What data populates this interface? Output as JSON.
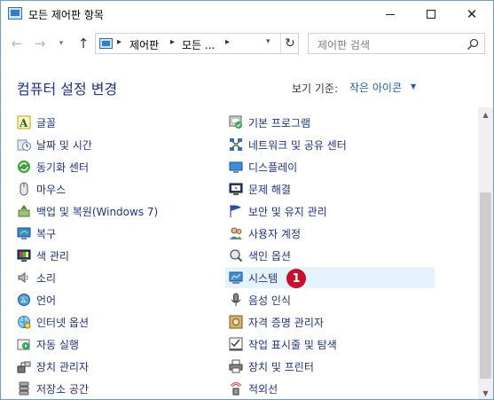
{
  "window": {
    "title": "모든 제어판 항목"
  },
  "nav": {
    "breadcrumb": [
      "제어판",
      "모든 ..."
    ],
    "search_placeholder": "제어판 검색"
  },
  "header": {
    "title": "컴퓨터 설정 변경",
    "view_by_label": "보기 기준:",
    "view_by_value": "작은 아이콘"
  },
  "items_left": [
    {
      "label": "글꼴",
      "icon": "font-icon"
    },
    {
      "label": "날짜 및 시간",
      "icon": "clock-icon"
    },
    {
      "label": "동기화 센터",
      "icon": "sync-icon"
    },
    {
      "label": "마우스",
      "icon": "mouse-icon"
    },
    {
      "label": "백업 및 복원(Windows 7)",
      "icon": "backup-icon"
    },
    {
      "label": "복구",
      "icon": "recovery-icon"
    },
    {
      "label": "색 관리",
      "icon": "color-management-icon"
    },
    {
      "label": "소리",
      "icon": "speaker-icon"
    },
    {
      "label": "언어",
      "icon": "language-icon"
    },
    {
      "label": "인터넷 옵션",
      "icon": "internet-options-icon"
    },
    {
      "label": "자동 실행",
      "icon": "autoplay-icon"
    },
    {
      "label": "장치 관리자",
      "icon": "device-manager-icon"
    },
    {
      "label": "저장소 공간",
      "icon": "storage-icon"
    }
  ],
  "items_right": [
    {
      "label": "기본 프로그램",
      "icon": "default-programs-icon"
    },
    {
      "label": "네트워크 및 공유 센터",
      "icon": "network-icon"
    },
    {
      "label": "디스플레이",
      "icon": "display-icon"
    },
    {
      "label": "문제 해결",
      "icon": "troubleshoot-icon"
    },
    {
      "label": "보안 및 유지 관리",
      "icon": "security-flag-icon"
    },
    {
      "label": "사용자 계정",
      "icon": "user-accounts-icon"
    },
    {
      "label": "색인 옵션",
      "icon": "indexing-icon"
    },
    {
      "label": "시스템",
      "icon": "system-icon"
    },
    {
      "label": "음성 인식",
      "icon": "microphone-icon"
    },
    {
      "label": "자격 증명 관리자",
      "icon": "credential-icon"
    },
    {
      "label": "작업 표시줄 및 탐색",
      "icon": "taskbar-icon"
    },
    {
      "label": "장치 및 프린터",
      "icon": "printer-icon"
    },
    {
      "label": "적외선",
      "icon": "infrared-icon"
    }
  ],
  "selected_item": "시스템",
  "annotation_badge": "1",
  "colors": {
    "link": "#1e3287",
    "selected_bg": "#e5f3ff",
    "badge": "#c8102e"
  }
}
